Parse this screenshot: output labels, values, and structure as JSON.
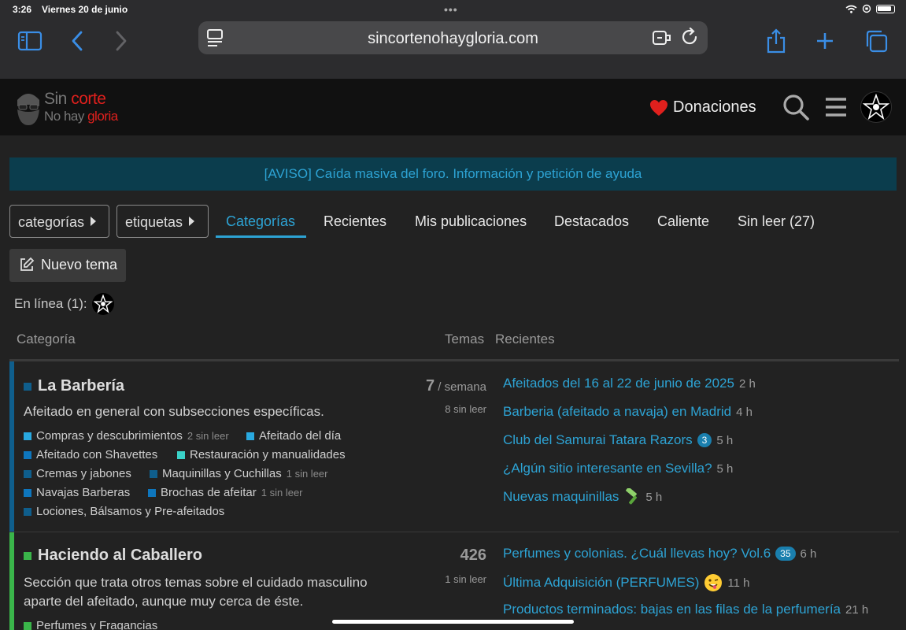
{
  "status_bar": {
    "time": "3:26",
    "date": "Viernes 20 de junio"
  },
  "browser": {
    "url": "sincortenohaygloria.com"
  },
  "site": {
    "logo_line1_a": "Sin ",
    "logo_line1_b": "corte",
    "logo_line2_a": "No hay ",
    "logo_line2_b": "gloria",
    "donations_label": "Donaciones",
    "brand_red": "#e0201d"
  },
  "banner": {
    "text": "[AVISO] Caída masiva del foro. Información y petición de ayuda"
  },
  "nav": {
    "categories_dropdown": "categorías",
    "tags_dropdown": "etiquetas",
    "links": [
      "Categorías",
      "Recientes",
      "Mis publicaciones",
      "Destacados",
      "Caliente",
      "Sin leer (27)"
    ],
    "active": "Categorías"
  },
  "new_topic_label": "Nuevo tema",
  "online_label": "En línea (1):",
  "table_headers": {
    "category": "Categoría",
    "topics": "Temas",
    "recent": "Recientes"
  },
  "categories": [
    {
      "name": "La Barbería",
      "color": "#0f5e8c",
      "description": "Afeitado en general con subsecciones específicas.",
      "topics": "7",
      "topics_period": " / semana",
      "topics_unread": "8 sin leer",
      "subcategories": [
        {
          "name": "Compras y descubrimientos",
          "unread": "2 sin leer",
          "color": "#29a9e0"
        },
        {
          "name": "Afeitado del día",
          "unread": "",
          "color": "#29a9e0"
        },
        {
          "name": "Afeitado con Shavettes",
          "unread": "",
          "color": "#0e76bd"
        },
        {
          "name": "Restauración y manualidades",
          "unread": "",
          "color": "#3ad2c8"
        },
        {
          "name": "Cremas y jabones",
          "unread": "",
          "color": "#0f5e8c"
        },
        {
          "name": "Maquinillas y Cuchillas",
          "unread": "1 sin leer",
          "color": "#0f5e8c"
        },
        {
          "name": "Navajas Barberas",
          "unread": "",
          "color": "#0e76bd"
        },
        {
          "name": "Brochas de afeitar",
          "unread": "1 sin leer",
          "color": "#0e76bd"
        },
        {
          "name": "Lociones, Bálsamos y Pre-afeitados",
          "unread": "",
          "color": "#0f5e8c"
        }
      ],
      "recent": [
        {
          "title": "Afeitados del 16 al 22 de junio de 2025",
          "badge": "",
          "age": "2 h"
        },
        {
          "title": "Barberia (afeitado a navaja) en Madrid",
          "badge": "",
          "age": "4 h"
        },
        {
          "title": "Club del Samurai Tatara Razors",
          "badge": "3",
          "age": "5 h"
        },
        {
          "title": "¿Algún sitio interesante en Sevilla?",
          "badge": "",
          "age": "5 h"
        },
        {
          "title": "Nuevas maquinillas",
          "badge": "",
          "age": "5 h"
        }
      ]
    },
    {
      "name": "Haciendo al Caballero",
      "color": "#3ab54a",
      "description": "Sección que trata otros temas sobre el cuidado masculino aparte del afeitado, aunque muy cerca de éste.",
      "topics": "426",
      "topics_unread": "1 sin leer",
      "subcategories": [
        {
          "name": "Perfumes y Fragancias",
          "unread": "",
          "color": "#3ab54a"
        }
      ],
      "recent": [
        {
          "title": "Perfumes y colonias. ¿Cuál llevas hoy? Vol.6",
          "badge": "35",
          "age": "6 h"
        },
        {
          "title": "Última Adquisición (PERFUMES)",
          "badge": "",
          "age": "11 h"
        },
        {
          "title": "Productos terminados: bajas en las filas de la perfumería",
          "badge": "",
          "age": "21 h"
        }
      ]
    }
  ],
  "accent_color": "#2da3d4"
}
